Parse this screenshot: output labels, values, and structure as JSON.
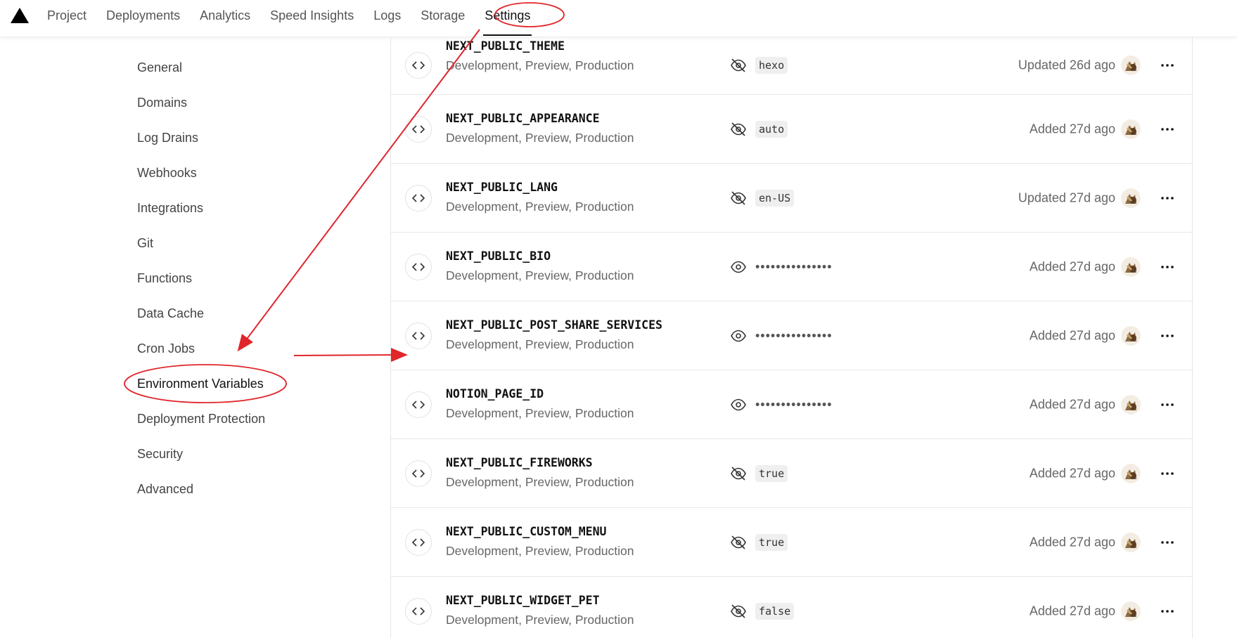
{
  "topnav": {
    "tabs": [
      {
        "label": "Project"
      },
      {
        "label": "Deployments"
      },
      {
        "label": "Analytics"
      },
      {
        "label": "Speed Insights"
      },
      {
        "label": "Logs"
      },
      {
        "label": "Storage"
      },
      {
        "label": "Settings"
      }
    ],
    "active": "Settings"
  },
  "sidebar": {
    "items": [
      {
        "label": "General"
      },
      {
        "label": "Domains"
      },
      {
        "label": "Log Drains"
      },
      {
        "label": "Webhooks"
      },
      {
        "label": "Integrations"
      },
      {
        "label": "Git"
      },
      {
        "label": "Functions"
      },
      {
        "label": "Data Cache"
      },
      {
        "label": "Cron Jobs"
      },
      {
        "label": "Environment Variables"
      },
      {
        "label": "Deployment Protection"
      },
      {
        "label": "Security"
      },
      {
        "label": "Advanced"
      }
    ],
    "active": "Environment Variables"
  },
  "env_vars": [
    {
      "name": "NEXT_PUBLIC_THEME",
      "targets": "Development, Preview, Production",
      "value": "hexo",
      "hidden": false,
      "updated": "Updated 26d ago"
    },
    {
      "name": "NEXT_PUBLIC_APPEARANCE",
      "targets": "Development, Preview, Production",
      "value": "auto",
      "hidden": false,
      "updated": "Added 27d ago"
    },
    {
      "name": "NEXT_PUBLIC_LANG",
      "targets": "Development, Preview, Production",
      "value": "en-US",
      "hidden": false,
      "updated": "Updated 27d ago"
    },
    {
      "name": "NEXT_PUBLIC_BIO",
      "targets": "Development, Preview, Production",
      "value": "•••••••••••••••",
      "hidden": true,
      "updated": "Added 27d ago"
    },
    {
      "name": "NEXT_PUBLIC_POST_SHARE_SERVICES",
      "targets": "Development, Preview, Production",
      "value": "•••••••••••••••",
      "hidden": true,
      "updated": "Added 27d ago"
    },
    {
      "name": "NOTION_PAGE_ID",
      "targets": "Development, Preview, Production",
      "value": "•••••••••••••••",
      "hidden": true,
      "updated": "Added 27d ago"
    },
    {
      "name": "NEXT_PUBLIC_FIREWORKS",
      "targets": "Development, Preview, Production",
      "value": "true",
      "hidden": false,
      "updated": "Added 27d ago"
    },
    {
      "name": "NEXT_PUBLIC_CUSTOM_MENU",
      "targets": "Development, Preview, Production",
      "value": "true",
      "hidden": false,
      "updated": "Added 27d ago"
    },
    {
      "name": "NEXT_PUBLIC_WIDGET_PET",
      "targets": "Development, Preview, Production",
      "value": "false",
      "hidden": false,
      "updated": "Added 27d ago"
    }
  ],
  "annotation_color": "#e0262b",
  "icons": {
    "code": "code-icon",
    "eye": "eye-icon",
    "eye_off": "eye-off-icon",
    "more": "more-horizontal-icon"
  }
}
